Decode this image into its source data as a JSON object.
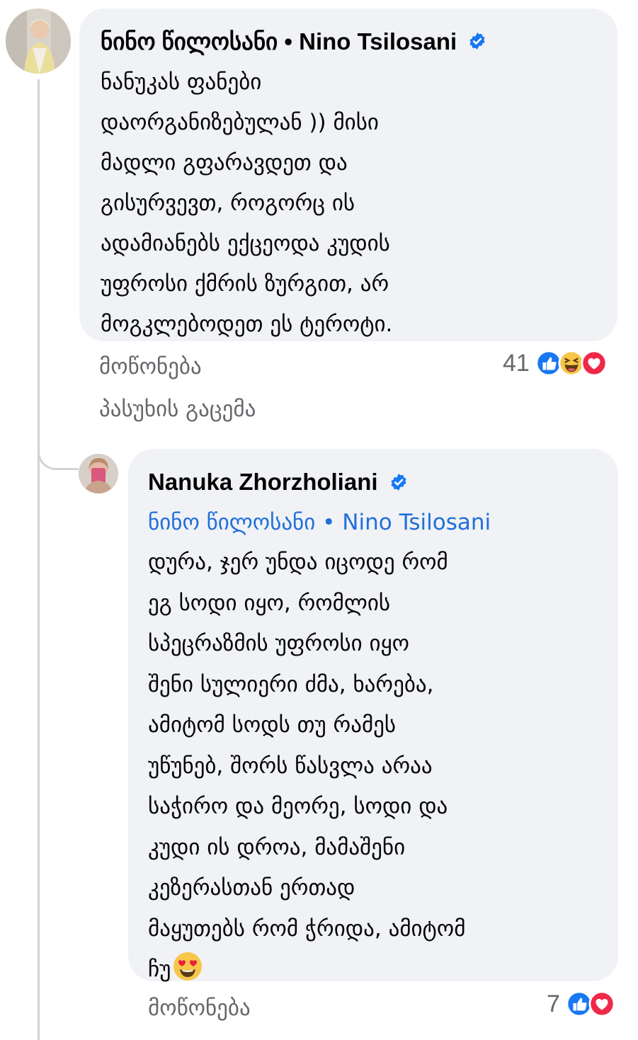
{
  "comment": {
    "author": "ნინო წილოსანი • Nino Tsilosani",
    "text": "ნანუკას ფანები\nდაორგანიზებულან )) მისი\nმადლი გფარავდეთ და\nგისურვევთ,  როგორც ის\nადამიანებს ექცეოდა კუდის\nუფროსი ქმრის ზურგით,  არ\nმოგკლებოდეთ ეს ტეროტი.",
    "like_label": "მოწონება",
    "reply_label": "პასუხის გაცემა",
    "reaction_count": "41",
    "reactions": [
      "like-icon",
      "haha-icon",
      "love-icon"
    ]
  },
  "reply": {
    "author": "Nanuka Zhorzholiani",
    "mention": "ნინო წილოსანი • Nino Tsilosani",
    "text": "დურა, ჯერ უნდა იცოდე რომ\nეგ სოდი იყო, რომლის\nსპეცრაზმის უფროსი იყო\nშენი სულიერი ძმა, ხარება,\nამიტომ სოდს თუ რამეს\nუწუნებ, შორს წასვლა არაა\nსაჭირო და მეორე, სოდი და\nკუდი ის დროა, მამაშენი\nკეზერასთან ერთად\nმაყუთებს რომ ჭრიდა, ამიტომ\nჩუ",
    "emoji": "heart-eyes-emoji",
    "like_label": "მოწონება",
    "reaction_count": "7",
    "reactions": [
      "like-icon",
      "love-icon"
    ]
  },
  "colors": {
    "bubble": "#f0f2f5",
    "text": "#050505",
    "secondary": "#65676b",
    "mention": "#216fdb",
    "verified": "#1877f2"
  }
}
